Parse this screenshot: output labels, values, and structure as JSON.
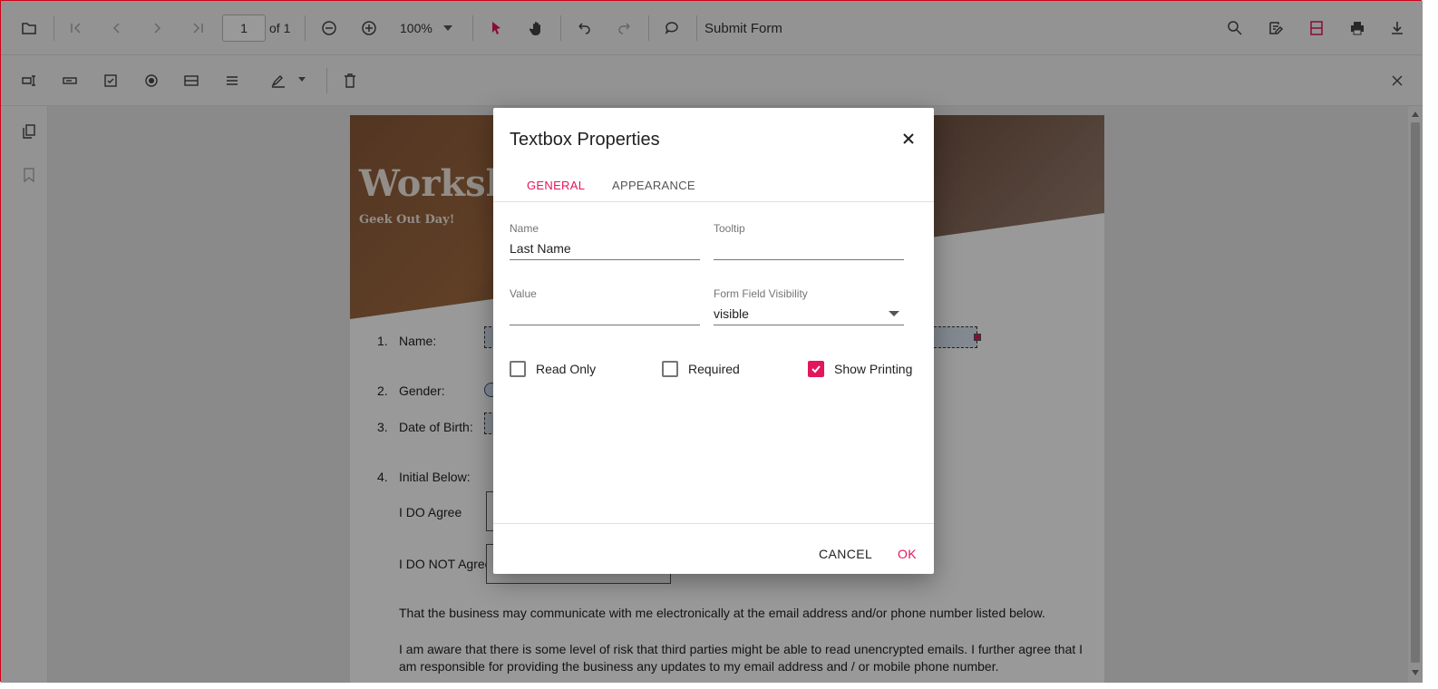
{
  "toolbar": {
    "current_page": "1",
    "page_count_label": "of 1",
    "zoom": "100%",
    "submit_label": "Submit Form",
    "icons": [
      "open-icon",
      "first-page-icon",
      "previous-page-icon",
      "next-page-icon",
      "last-page-icon",
      "zoom-out-icon",
      "zoom-in-icon",
      "select-pointer-icon",
      "pan-hand-icon",
      "undo-icon",
      "redo-icon",
      "comment-icon",
      "search-icon",
      "edit-annotation-icon",
      "form-designer-icon",
      "print-icon",
      "download-icon"
    ]
  },
  "annot_toolbar": {
    "icons": [
      "textbox-field-icon",
      "password-field-icon",
      "checkbox-field-icon",
      "radio-field-icon",
      "dropdown-field-icon",
      "listbox-field-icon",
      "signature-field-icon",
      "delete-icon",
      "close-icon"
    ]
  },
  "document": {
    "hero_title": "Worksh",
    "hero_subtitle": "Geek Out Day!",
    "items": [
      {
        "num": "1.",
        "label": "Name:"
      },
      {
        "num": "2.",
        "label": "Gender:"
      },
      {
        "num": "3.",
        "label": "Date of Birth:"
      },
      {
        "num": "4.",
        "label": "Initial Below:"
      }
    ],
    "agree": "I DO Agree",
    "not_agree": "I DO NOT Agree",
    "para1": "That the business may communicate with me electronically at the email address and/or phone number listed below.",
    "para2": "I am aware that there is some level of risk that third parties might be able to read unencrypted emails. I further agree that I am responsible for providing the business any updates to my email address and / or mobile phone number."
  },
  "dialog": {
    "title": "Textbox Properties",
    "tabs": [
      "GENERAL",
      "APPEARANCE"
    ],
    "name_label": "Name",
    "name_value": "Last Name",
    "tooltip_label": "Tooltip",
    "tooltip_value": "",
    "value_label": "Value",
    "value_value": "",
    "visibility_label": "Form Field Visibility",
    "visibility_value": "visible",
    "checkboxes": [
      {
        "label": "Read Only",
        "checked": false
      },
      {
        "label": "Required",
        "checked": false
      },
      {
        "label": "Show Printing",
        "checked": true
      }
    ],
    "cancel": "CANCEL",
    "ok": "OK"
  },
  "colors": {
    "accent": "#e3165b",
    "overlay": "rgba(0,0,0,0.4)"
  }
}
